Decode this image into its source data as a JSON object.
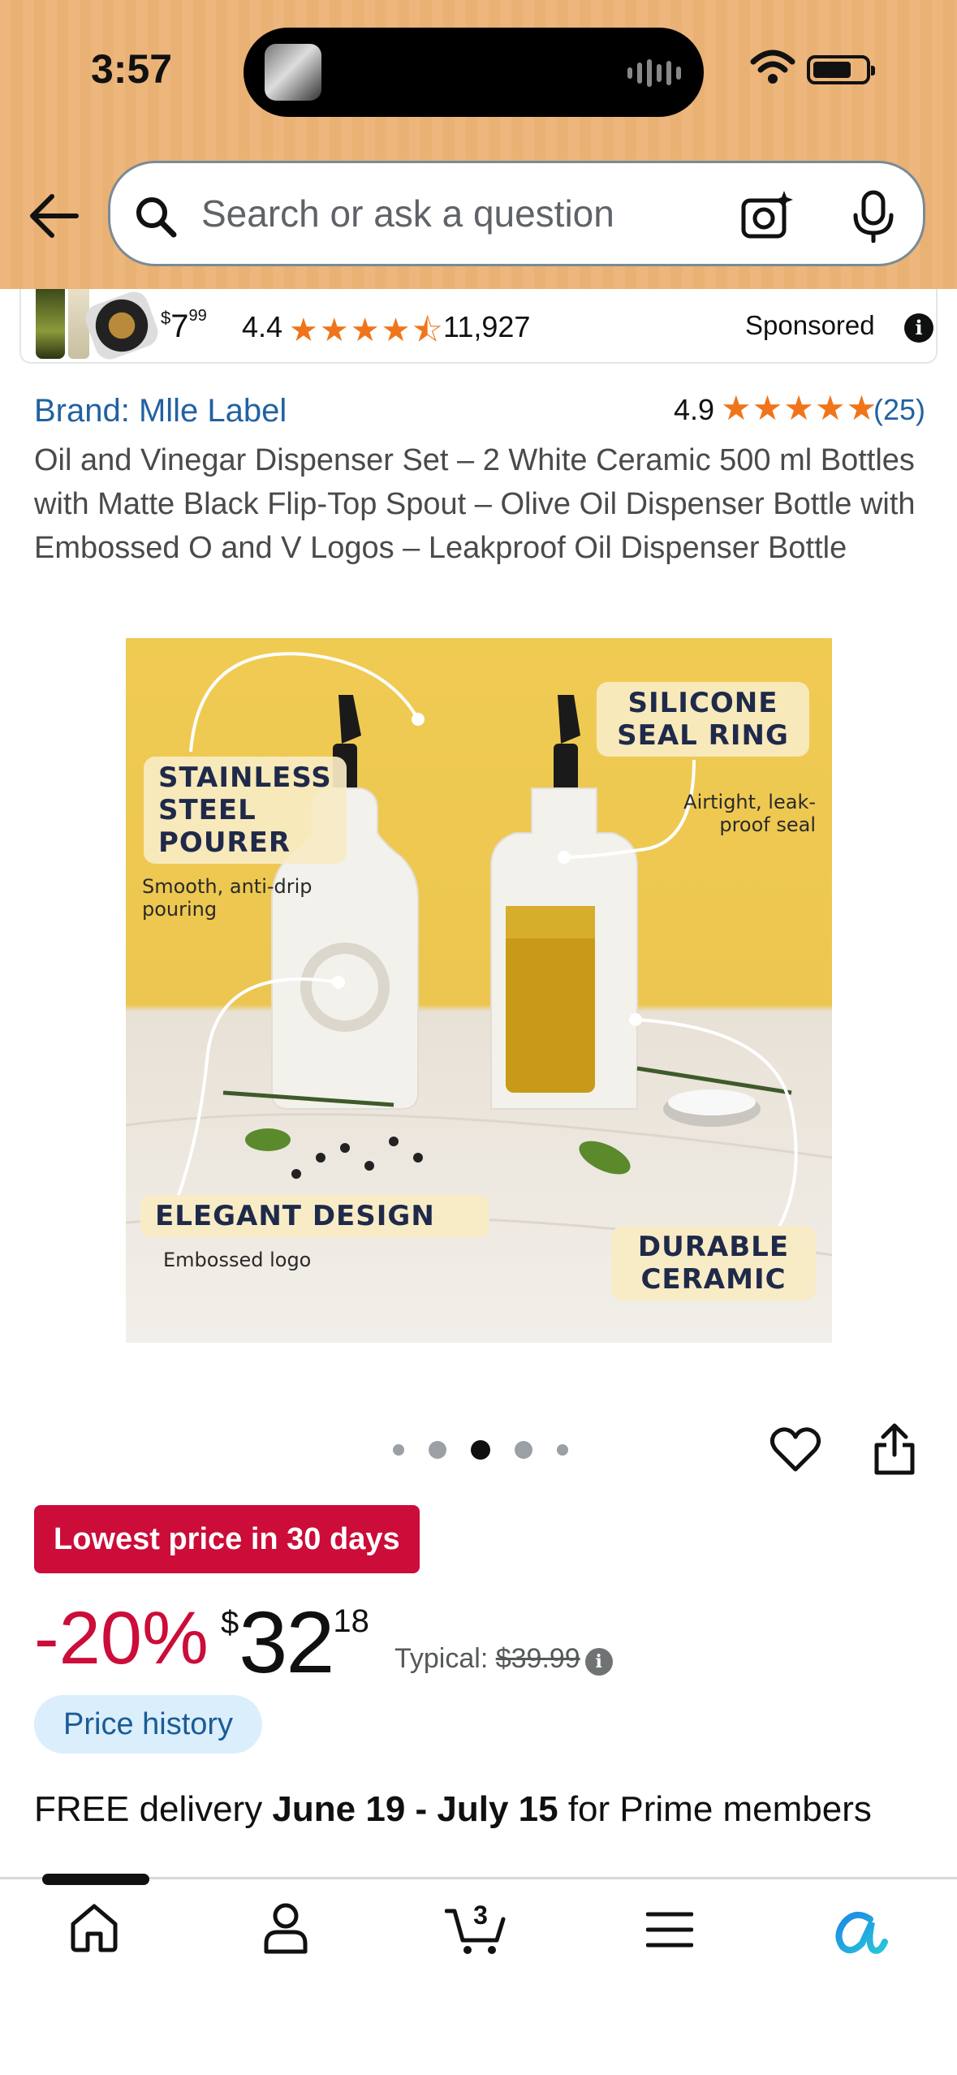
{
  "status_bar": {
    "time": "3:57"
  },
  "search": {
    "placeholder": "Search or ask a question"
  },
  "sponsored_ad": {
    "price_currency": "$",
    "price_whole": "7",
    "price_fraction": "99",
    "rating": "4.4",
    "rating_count": "11,927",
    "label": "Sponsored"
  },
  "product": {
    "brand": "Brand: Mlle Label",
    "rating": "4.9",
    "rating_count": "(25)",
    "title": "Oil and Vinegar Dispenser Set – 2 White Ceramic 500 ml Bottles with Matte Black Flip-Top Spout – Olive Oil Dispenser Bottle with Embossed O and V Logos – Leakproof Oil Dispenser Bottle",
    "image_labels": {
      "stainless_title": "STAINLESS STEEL POURER",
      "stainless_sub": "Smooth, anti-drip pouring",
      "silicone_title": "SILICONE SEAL RING",
      "silicone_sub": "Airtight, leak-proof seal",
      "elegant_title": "ELEGANT DESIGN",
      "elegant_sub": "Embossed logo",
      "durable_title": "DURABLE CERAMIC"
    },
    "carousel": {
      "count": 5,
      "active_index": 2
    }
  },
  "pricing": {
    "deal_badge": "Lowest price in 30 days",
    "discount": "-20%",
    "currency": "$",
    "price_whole": "32",
    "price_fraction": "18",
    "typical_label": "Typical:",
    "typical_price": "$39.99",
    "price_history": "Price history"
  },
  "delivery": {
    "prefix": "FREE delivery",
    "dates": "June 19 - July 15",
    "suffix": "for Prime members"
  },
  "bottom_nav": {
    "cart_count": "3"
  },
  "colors": {
    "header": "#ecb67c",
    "deal_red": "#cc0c39",
    "link_blue": "#2162a1",
    "star_orange": "#f0741a"
  }
}
